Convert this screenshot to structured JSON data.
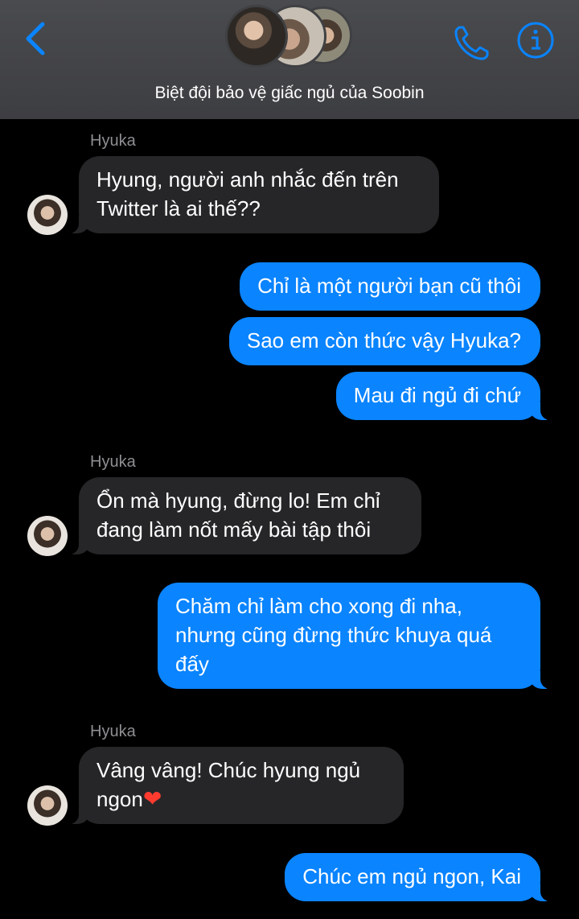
{
  "header": {
    "title": "Biệt đội bảo vệ giấc ngủ của Soobin",
    "accent_color": "#0a84ff",
    "icons": [
      "chevron-left-icon",
      "phone-icon",
      "info-icon"
    ]
  },
  "messages": [
    {
      "sender": "Hyuka"
    },
    {
      "text": "Hyung, người anh nhắc đến trên\nTwitter là ai thế??"
    },
    {
      "text": "Chỉ là một người bạn cũ thôi"
    },
    {
      "text": "Sao em còn thức vậy Hyuka?"
    },
    {
      "text": "Mau đi ngủ đi chứ"
    },
    {
      "sender": "Hyuka"
    },
    {
      "text": "Ổn mà hyung, đừng lo! Em chỉ\nđang làm nốt mấy bài tập thôi"
    },
    {
      "text": "Chăm chỉ làm cho xong đi nha,\nnhưng cũng đừng thức khuya quá\nđấy"
    },
    {
      "sender": "Hyuka"
    },
    {
      "text": "Vâng vâng! Chúc hyung ngủ\nngon",
      "emoji": "❤"
    },
    {
      "text": "Chúc em ngủ ngon, Kai"
    }
  ]
}
